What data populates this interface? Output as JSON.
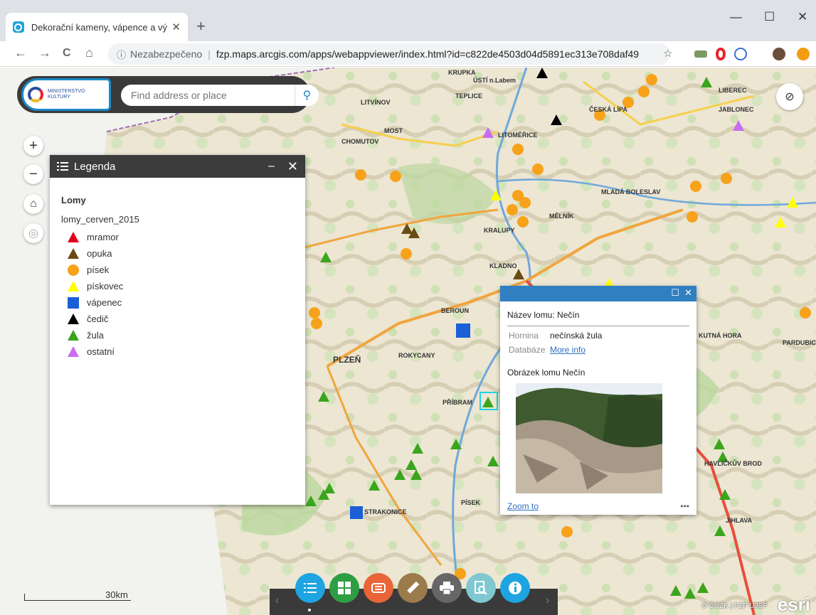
{
  "browser": {
    "tab_title": "Dekorační kameny, vápence a vý",
    "tab_close": "✕",
    "new_tab": "+",
    "not_secure": "Nezabezpečeno",
    "url": "fzp.maps.arcgis.com/apps/webappviewer/index.html?id=c822de4503d04d5891ec313e708daf49",
    "window_controls": {
      "minimize": "—",
      "maximize": "☐",
      "close": "✕"
    },
    "nav": {
      "back": "←",
      "forward": "→",
      "reload": "C",
      "home": "⌂"
    },
    "info_icon": "ⓘ",
    "star": "☆",
    "separator": "|"
  },
  "search": {
    "placeholder": "Find address or place",
    "logo_text": "MINISTERSTVO KULTURY",
    "search_icon": "⚲"
  },
  "map_controls": {
    "zoom_in": "+",
    "zoom_out": "−",
    "home": "⌂",
    "locate": "◎",
    "visibility": "⊘"
  },
  "legend": {
    "title": "Legenda",
    "minimize": "–",
    "close": "✕",
    "layer": "Lomy",
    "sublayer": "lomy_cerven_2015",
    "items": [
      {
        "label": "mramor",
        "shape": "triangle",
        "color": "#e3001b"
      },
      {
        "label": "opuka",
        "shape": "triangle",
        "color": "#6b4a12"
      },
      {
        "label": "písek",
        "shape": "circle",
        "color": "#f7a21a"
      },
      {
        "label": "pískovec",
        "shape": "triangle",
        "color": "#ffff00"
      },
      {
        "label": "vápenec",
        "shape": "square",
        "color": "#1a5fd6"
      },
      {
        "label": "čedič",
        "shape": "triangle",
        "color": "#000000"
      },
      {
        "label": "žula",
        "shape": "triangle",
        "color": "#3aa51d"
      },
      {
        "label": "ostatní",
        "shape": "triangle",
        "color": "#c86cf0"
      }
    ]
  },
  "popup": {
    "title": "Název lomu: Nečín",
    "rock_label": "Hornina",
    "rock_value": "nečínská žula",
    "db_label": "Databáze",
    "db_link": "More info",
    "image_title": "Obrázek lomu Nečín",
    "zoom_to": "Zoom to",
    "more": "•••",
    "maximize": "☐",
    "close": "✕"
  },
  "dock": {
    "prev": "‹",
    "next": "›"
  },
  "scale": {
    "label": "30km"
  },
  "attribution": "© ČÚZK | FZP UJEP",
  "esri": "esri",
  "map_labels": [
    {
      "text": "MOST"
    },
    {
      "text": "CHOMUTOV"
    },
    {
      "text": "LITOMĚŘICE"
    },
    {
      "text": "TEPLICE"
    },
    {
      "text": "LITVÍNOV"
    },
    {
      "text": "KLADNO"
    },
    {
      "text": "BEROUN"
    },
    {
      "text": "PLZEŇ"
    },
    {
      "text": "PŘÍBRAM"
    },
    {
      "text": "PÍSEK"
    },
    {
      "text": "STRAKONICE"
    },
    {
      "text": "KUTNÁ HORA"
    },
    {
      "text": "HAVLÍČKŮV BROD"
    },
    {
      "text": "JIHLAVA"
    },
    {
      "text": "MLADÁ BOLESLAV"
    },
    {
      "text": "LIBEREC"
    },
    {
      "text": "ČESKÁ LÍPA"
    },
    {
      "text": "MĚLNÍK"
    },
    {
      "text": "PARDUBICE"
    },
    {
      "text": "JABLONEC"
    },
    {
      "text": "ÚSTÍ n.Labem"
    },
    {
      "text": "KRALUPY"
    },
    {
      "text": "ROKYCANY"
    },
    {
      "text": "KRUPKA"
    }
  ]
}
